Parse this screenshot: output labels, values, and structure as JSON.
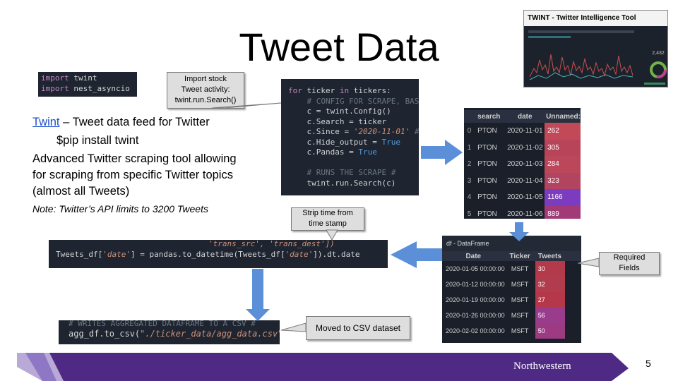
{
  "slide": {
    "title": "Tweet Data",
    "page_number": "5",
    "brand": "Northwestern"
  },
  "import_code": {
    "line1_kw": "import",
    "line1_rest": " twint",
    "line2_kw": "import",
    "line2_rest": " nest_asyncio"
  },
  "left_text": {
    "link": "Twint",
    "feed": " – Tweet data feed for Twitter",
    "pip": "$pip install twint",
    "desc1": "Advanced Twitter scraping tool allowing",
    "desc2": "for scraping from specific Twitter topics",
    "desc3": "(almost all Tweets)",
    "note": "Note: Twitter’s API limits to 3200 Tweets"
  },
  "callouts": {
    "import_stock": [
      "Import stock",
      "Tweet  activity:",
      "twint.run.Search()"
    ],
    "strip_time": [
      "Strip time from",
      "time stamp"
    ],
    "required": [
      "Required",
      "Fields"
    ],
    "moved": "Moved to CSV dataset"
  },
  "loop_code": {
    "l1_kw1": "for",
    "l1_mid": " ticker ",
    "l1_kw2": "in",
    "l1_end": " tickers:",
    "l2": "    # CONFIG FOR SCRAPE, BAS",
    "l3": "    c = twint.Config()",
    "l4": "    c.Search = ticker",
    "l5_a": "    c.Since = ",
    "l5_s": "'2020-11-01'",
    "l5_c": " #",
    "l6_a": "    c.Hide_output = ",
    "l6_t": "True",
    "l7_a": "    c.Pandas = ",
    "l7_t": "True",
    "l8": "",
    "l9": "    # RUNS THE SCRAPE #",
    "l10": "    twint.run.Search(c)"
  },
  "date_code": {
    "top": "'trans_src', 'trans_dest'])",
    "a": "Tweets_df[",
    "s1": "'date'",
    "b": "] = pandas.to_datetime(Tweets_df[",
    "s2": "'date'",
    "c": "]).dt.date"
  },
  "csv_code": {
    "top": "# WRITES AGGREGATED DATAFRAME TO A CSV #",
    "a": "agg_df.to_csv(",
    "s": "\"./ticker_data/agg_data.csv\"",
    "b": ")"
  },
  "search_table": {
    "headers": [
      "",
      "search",
      "date",
      "Unnamed:"
    ],
    "rows": [
      [
        "0",
        "PTON",
        "2020-11-01",
        "262"
      ],
      [
        "1",
        "PTON",
        "2020-11-02",
        "305"
      ],
      [
        "2",
        "PTON",
        "2020-11-03",
        "284"
      ],
      [
        "3",
        "PTON",
        "2020-11-04",
        "323"
      ],
      [
        "4",
        "PTON",
        "2020-11-05",
        "1166"
      ],
      [
        "5",
        "PTON",
        "2020-11-06",
        "889"
      ]
    ],
    "colors": [
      "#c24a58",
      "#b8445a",
      "#bc465a",
      "#b24460",
      "#7b3cc0",
      "#a23a78"
    ]
  },
  "agg_table": {
    "title": "df - DataFrame",
    "headers": [
      "Date",
      "Ticker",
      "Tweets"
    ],
    "rows": [
      [
        "2020-01-05 00:00:00",
        "MSFT",
        "30"
      ],
      [
        "2020-01-12 00:00:00",
        "MSFT",
        "32"
      ],
      [
        "2020-01-19 00:00:00",
        "MSFT",
        "27"
      ],
      [
        "2020-01-26 00:00:00",
        "MSFT",
        "56"
      ],
      [
        "2020-02-02 00:00:00",
        "MSFT",
        "50"
      ]
    ],
    "colors": [
      "#b23a4a",
      "#b13c4e",
      "#b5384a",
      "#9a3c8c",
      "#9c3a82"
    ]
  },
  "twint_thumb": {
    "caption": "TWINT - Twitter Intelligence Tool",
    "stat": "2,432"
  },
  "colors": {
    "code_bg": "#1e2430",
    "arrow": "#5b8fd8",
    "footer_purple": "#4e2a84",
    "link": "#1f4fcc"
  }
}
